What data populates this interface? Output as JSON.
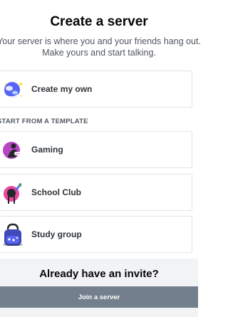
{
  "modal": {
    "title": "Create a server",
    "subtitle": "Your server is where you and your friends hang out. Make yours and start talking."
  },
  "options": {
    "create_own": {
      "label": "Create my own",
      "icon": "globe-illustration-icon"
    },
    "template_header": "START FROM A TEMPLATE",
    "templates": [
      {
        "label": "Gaming",
        "icon": "gaming-illustration-icon"
      },
      {
        "label": "School Club",
        "icon": "school-club-illustration-icon"
      },
      {
        "label": "Study group",
        "icon": "study-group-illustration-icon"
      }
    ]
  },
  "footer": {
    "title": "Already have an invite?",
    "join_label": "Join a server"
  },
  "colors": {
    "footer_bg": "#f2f3f5",
    "join_button": "#747f8d",
    "border": "#e3e5e8"
  }
}
